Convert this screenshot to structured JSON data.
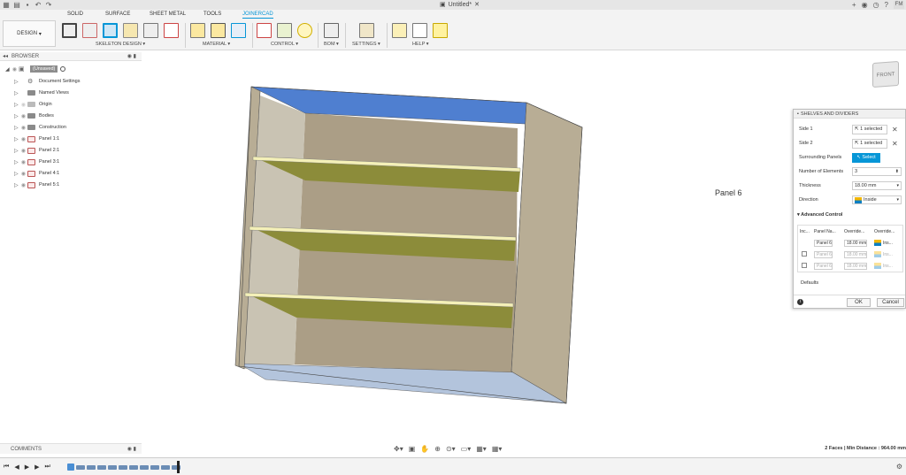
{
  "titlebar": {
    "doc_title": "Untitled*",
    "user_initials": "FM"
  },
  "tabs": [
    "SOLID",
    "SURFACE",
    "SHEET METAL",
    "TOOLS",
    "JOINERCAD"
  ],
  "active_tab": "JOINERCAD",
  "design_label": "DESIGN",
  "ribbon_groups": [
    "SKELETON DESIGN",
    "MATERIAL",
    "CONTROL",
    "BOM",
    "SETTINGS",
    "HELP"
  ],
  "browser": {
    "title": "BROWSER",
    "root": "(Unsaved)",
    "items": [
      "Document Settings",
      "Named Views",
      "Origin",
      "Bodies",
      "Construction",
      "Panel 1:1",
      "Panel 2:1",
      "Panel 3:1",
      "Panel 4:1",
      "Panel 5:1"
    ]
  },
  "comments_label": "COMMENTS",
  "viewcube_label": "FRONT",
  "viewport_label": "Panel 6",
  "status": "2 Faces | Min Distance : 964.00 mm",
  "dialog": {
    "title": "SHELVES AND DIVIDERS",
    "side1_label": "Side 1",
    "side1_value": "1 selected",
    "side2_label": "Side 2",
    "side2_value": "1 selected",
    "surrounding_label": "Surrounding Panels",
    "surrounding_button": "Select",
    "num_elements_label": "Number of Elements",
    "num_elements_value": "3",
    "thickness_label": "Thickness",
    "thickness_value": "18.00 mm",
    "direction_label": "Direction",
    "direction_value": "Inside",
    "advanced_label": "Advanced Control",
    "table_headers": [
      "Inc...",
      "Panel Na...",
      "Override...",
      "Override..."
    ],
    "table_rows": [
      {
        "panel": "Panel 6",
        "thickness": "18.00 mm",
        "dir": "Ins..."
      },
      {
        "panel": "Panel 6",
        "thickness": "18.00 mm",
        "dir": "Ins..."
      },
      {
        "panel": "Panel 6",
        "thickness": "18.00 mm",
        "dir": "Ins..."
      }
    ],
    "defaults_label": "Defaults",
    "ok_label": "OK",
    "cancel_label": "Cancel"
  },
  "colors": {
    "accent": "#0696d7",
    "shelf": "#8c8c3a",
    "panel": "#b8ad95",
    "top_panel": "#4f7fd0"
  }
}
